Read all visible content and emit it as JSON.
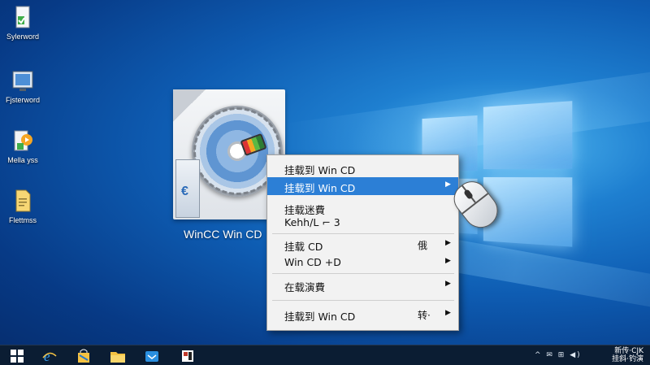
{
  "desktop": {
    "icons": [
      {
        "label": "Sylerword",
        "icon": "document-check-icon"
      },
      {
        "label": "Fjsterword",
        "icon": "monitor-icon"
      },
      {
        "label": "Mella yss",
        "icon": "media-player-icon"
      },
      {
        "label": "Flettmss",
        "icon": "document-icon"
      }
    ],
    "cd_icon": {
      "label": "WinCC Win CD",
      "icon": "cd-disc-icon"
    }
  },
  "context_menu": {
    "items": [
      {
        "label": "挂载到 Win CD",
        "shortcut": "",
        "submenu": false,
        "highlighted": false
      },
      {
        "label": "挂载到 Win CD",
        "shortcut": "",
        "submenu": true,
        "highlighted": true
      },
      {
        "label": "挂载迷費",
        "shortcut": "",
        "submenu": false,
        "highlighted": false
      },
      {
        "label": "Kehh/L ⌐ 3",
        "shortcut": "",
        "submenu": false,
        "highlighted": false
      },
      {
        "label": "挂载 CD",
        "shortcut": "俄",
        "submenu": true,
        "highlighted": false
      },
      {
        "label": "Win CD +D",
        "shortcut": "",
        "submenu": true,
        "highlighted": false
      },
      {
        "label": "在载演費",
        "shortcut": "",
        "submenu": true,
        "highlighted": false
      },
      {
        "label": "挂载到 Win CD",
        "shortcut": "转·",
        "submenu": true,
        "highlighted": false
      }
    ],
    "submenu_arrow": "▶"
  },
  "taskbar": {
    "apps": [
      {
        "name": "start-button",
        "icon": "windows-icon"
      },
      {
        "name": "edge",
        "icon": "browser-e-icon"
      },
      {
        "name": "store",
        "icon": "store-bag-icon"
      },
      {
        "name": "explorer",
        "icon": "folder-icon"
      },
      {
        "name": "mail",
        "icon": "mail-icon"
      },
      {
        "name": "media",
        "icon": "media-icon"
      }
    ],
    "tray_icons": "^ ✉ ⊞ ◀)",
    "clock_line1": "新传·CJK",
    "clock_line2": "挂斜·钓演"
  },
  "colors": {
    "menu_highlight": "#2c7fd6",
    "taskbar_bg": "#0b1d33"
  }
}
